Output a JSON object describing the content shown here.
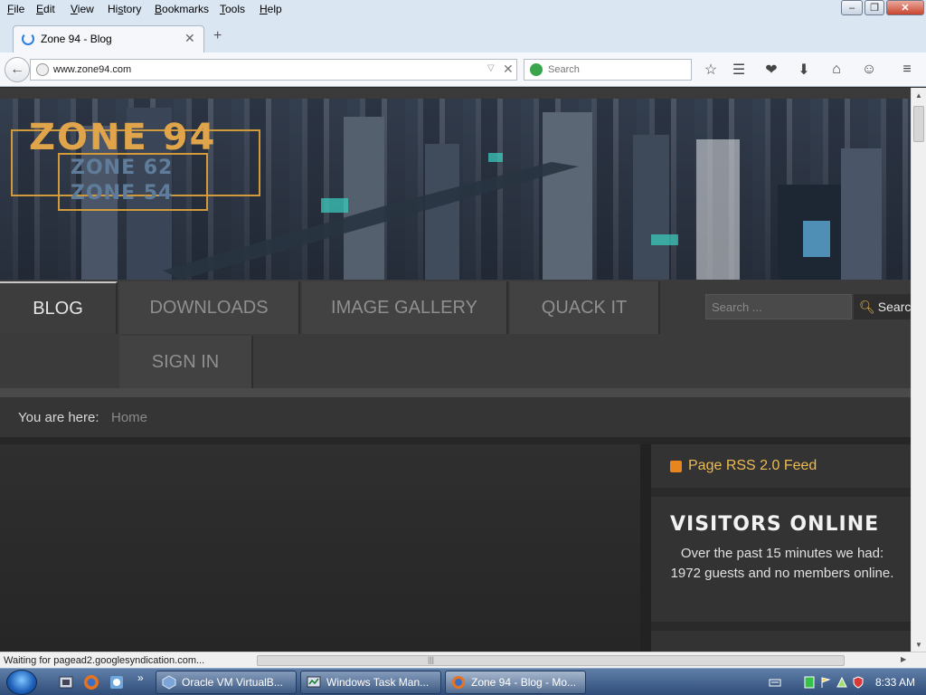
{
  "browser": {
    "menu": [
      "File",
      "Edit",
      "View",
      "History",
      "Bookmarks",
      "Tools",
      "Help"
    ],
    "menu_accel": [
      "F",
      "E",
      "V",
      "s",
      "B",
      "T",
      "H"
    ],
    "tab_title": "Zone 94 - Blog",
    "new_tab_glyph": "+",
    "url": "www.zone94.com",
    "search_placeholder": "Search",
    "status": "Waiting for pagead2.googlesyndication.com..."
  },
  "site": {
    "logo": {
      "main": "ZONE 94",
      "sub1": "ZONE 62",
      "sub2": "ZONE 54"
    },
    "nav": {
      "blog": "BLOG",
      "downloads": "DOWNLOADS",
      "gallery": "IMAGE GALLERY",
      "quack": "QUACK IT",
      "signin": "SIGN IN"
    },
    "search": {
      "placeholder": "Search ...",
      "button": "Search"
    },
    "breadcrumb": {
      "label": "You are here:",
      "current": "Home"
    },
    "sidebar": {
      "rss": "Page RSS 2.0 Feed",
      "visitors_title": "VISITORS ONLINE",
      "visitors_text": "Over the past 15 minutes we had: 1972 guests and no members online."
    }
  },
  "taskbar": {
    "tasks": [
      {
        "label": "Oracle VM VirtualB..."
      },
      {
        "label": "Windows Task Man..."
      },
      {
        "label": "Zone 94 - Blog - Mo..."
      }
    ],
    "more_glyph": "»",
    "clock": "8:33 AM"
  },
  "colors": {
    "accent_gold": "#ecbb52",
    "logo_gold": "#e0a54a",
    "taskbar": "#2f4d78"
  }
}
